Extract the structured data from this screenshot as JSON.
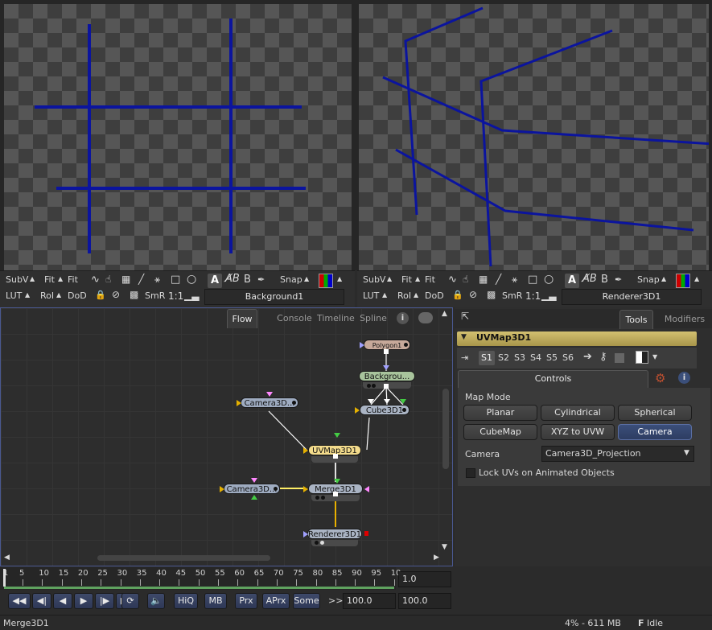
{
  "viewer_left": {
    "subv": "SubV",
    "fit1": "Fit",
    "fit2": "Fit",
    "lut": "LUT",
    "roi": "RoI",
    "dod": "DoD",
    "smr": "SmR",
    "ratio": "1:1",
    "snap": "Snap",
    "a": "A",
    "b": "B",
    "view_name": "Background1"
  },
  "viewer_right": {
    "subv": "SubV",
    "fit1": "Fit",
    "fit2": "Fit",
    "lut": "LUT",
    "roi": "RoI",
    "dod": "DoD",
    "smr": "SmR",
    "ratio": "1:1",
    "snap": "Snap",
    "a": "A",
    "b": "B",
    "view_name": "Renderer3D1"
  },
  "flow_tabs": [
    "Flow",
    "Console",
    "Timeline",
    "Spline"
  ],
  "nodes": {
    "polygon": "Polygon1",
    "background": "Backgrou...",
    "cube": "Cube3D1",
    "camera_top": "Camera3D...",
    "uvmap": "UVMap3D1",
    "camera_bottom": "Camera3D...",
    "merge": "Merge3D1",
    "renderer": "Renderer3D1"
  },
  "inspector": {
    "tabs": [
      "Tools",
      "Modifiers"
    ],
    "tool_name": "UVMap3D1",
    "slots": [
      "S1",
      "S2",
      "S3",
      "S4",
      "S5",
      "S6"
    ],
    "controls_tab": "Controls",
    "map_mode_label": "Map Mode",
    "map_mode_buttons": [
      "Planar",
      "Cylindrical",
      "Spherical",
      "CubeMap",
      "XYZ to UVW",
      "Camera"
    ],
    "selected_mode": "Camera",
    "camera_label": "Camera",
    "camera_value": "Camera3D_Projection",
    "lock_uvs_label": "Lock UVs on Animated Objects"
  },
  "timeline": {
    "ticks": [
      "1",
      "5",
      "10",
      "15",
      "20",
      "25",
      "30",
      "35",
      "40",
      "45",
      "50",
      "55",
      "60",
      "65",
      "70",
      "75",
      "80",
      "85",
      "90",
      "95",
      "10"
    ],
    "current_frame": "1.0",
    "render_end": "100.0",
    "global_end": "100.0",
    "buttons": [
      "HiQ",
      "MB",
      "Prx",
      "APrx",
      "Some"
    ],
    "more": ">>"
  },
  "status": {
    "message": "Merge3D1",
    "memory": "4% - 611 MB",
    "state_icon": "F",
    "state": "Idle"
  },
  "colors": {
    "line_blue": "#0b149e",
    "selection_blue": "#4a5890",
    "node_yellow": "#f4dc8c"
  }
}
